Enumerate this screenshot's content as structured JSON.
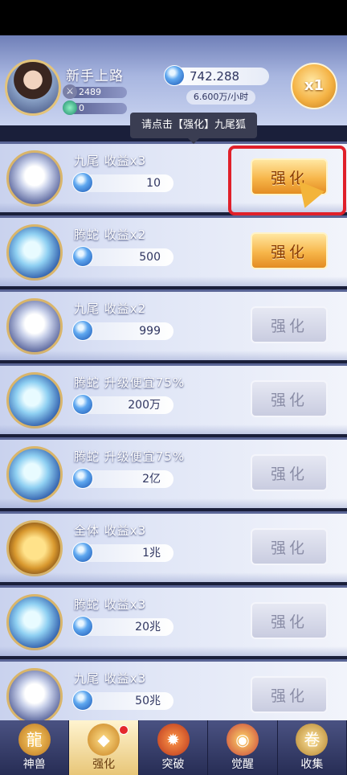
{
  "player": {
    "name": "新手上路",
    "power": "2489",
    "jade": "0"
  },
  "currency": {
    "amount": "742.288",
    "rate": "6.600万/小时"
  },
  "multiplier": "x1",
  "hint": "请点击【强化】九尾狐",
  "rows": [
    {
      "title": "九尾 收益x3",
      "cost": "10",
      "button": "强化",
      "state": "active"
    },
    {
      "title": "腾蛇 收益x2",
      "cost": "500",
      "button": "强化",
      "state": "active"
    },
    {
      "title": "九尾 收益x2",
      "cost": "999",
      "button": "强化",
      "state": "inactive"
    },
    {
      "title": "腾蛇 升级便宜75%",
      "cost": "200万",
      "button": "强化",
      "state": "inactive"
    },
    {
      "title": "腾蛇 升级便宜75%",
      "cost": "2亿",
      "button": "强化",
      "state": "inactive"
    },
    {
      "title": "全体 收益x3",
      "cost": "1兆",
      "button": "强化",
      "state": "inactive"
    },
    {
      "title": "腾蛇 收益x3",
      "cost": "20兆",
      "button": "强化",
      "state": "inactive"
    },
    {
      "title": "九尾 收益x3",
      "cost": "50兆",
      "button": "强化",
      "state": "inactive"
    }
  ],
  "nav": [
    {
      "label": "神兽",
      "icon": "dragon-icon"
    },
    {
      "label": "强化",
      "icon": "enhance-icon"
    },
    {
      "label": "突破",
      "icon": "breakthrough-icon"
    },
    {
      "label": "觉醒",
      "icon": "awaken-icon"
    },
    {
      "label": "收集",
      "icon": "scroll-icon"
    }
  ],
  "colors": {
    "active_button": "#f7b64a",
    "highlight": "#e0202a",
    "notification": "#e4282c"
  }
}
